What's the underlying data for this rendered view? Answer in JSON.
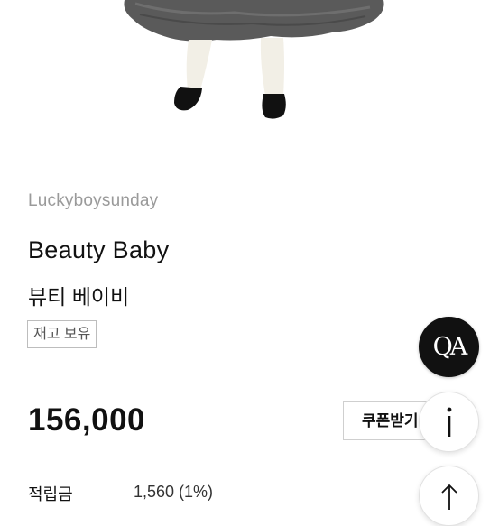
{
  "product": {
    "brand": "Luckyboysunday",
    "title_en": "Beauty Baby",
    "title_ko": "뷰티 베이비",
    "stock_badge": "재고 보유",
    "price": "156,000",
    "coupon_label": "쿠폰받기",
    "points_label": "적립금",
    "points_value": "1,560 (1%)"
  },
  "floating_buttons": {
    "qa_label": "QA",
    "info_icon": "info-icon",
    "top_icon": "arrow-up-icon"
  },
  "colors": {
    "brand_text": "#9a9a9a",
    "qa_background": "#111111"
  }
}
